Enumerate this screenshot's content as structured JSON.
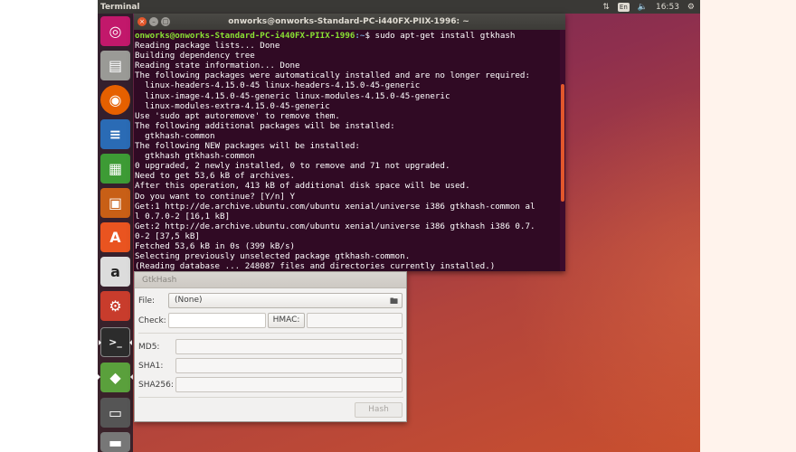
{
  "top_panel": {
    "title": "Terminal",
    "keyboard_layout": "En",
    "clock": "16:53"
  },
  "launcher": {
    "items": [
      {
        "name": "dash",
        "icon": "ubuntu-logo-icon",
        "color": "#c2186b"
      },
      {
        "name": "files",
        "icon": "file-cabinet-icon",
        "color": "#9a9a96"
      },
      {
        "name": "firefox",
        "icon": "firefox-icon",
        "color": "#e66000"
      },
      {
        "name": "writer",
        "icon": "writer-document-icon",
        "color": "#2a6bb5"
      },
      {
        "name": "calc",
        "icon": "calc-spreadsheet-icon",
        "color": "#3d9b35"
      },
      {
        "name": "impress",
        "icon": "impress-presentation-icon",
        "color": "#c85f16"
      },
      {
        "name": "software",
        "icon": "software-center-icon",
        "color": "#e95420"
      },
      {
        "name": "amazon",
        "icon": "amazon-icon",
        "color": "#dcdcdc"
      },
      {
        "name": "settings",
        "icon": "settings-gear-icon",
        "color": "#c83c2c"
      },
      {
        "name": "terminal",
        "icon": "terminal-icon",
        "color": "#2c2c2c"
      },
      {
        "name": "gtkhash",
        "icon": "gtkhash-icon",
        "color": "#5aa03c"
      },
      {
        "name": "save",
        "icon": "floppy-disk-icon",
        "color": "#555555"
      },
      {
        "name": "drive",
        "icon": "drive-icon",
        "color": "#777777"
      }
    ]
  },
  "terminal": {
    "title": "onworks@onworks-Standard-PC-i440FX-PIIX-1996: ~",
    "prompt_user": "onworks@onworks-Standard-PC-i440FX-PIIX-1996",
    "prompt_path": ":~",
    "command": "$ sudo apt-get install gtkhash",
    "lines": [
      "Reading package lists... Done",
      "Building dependency tree",
      "Reading state information... Done",
      "The following packages were automatically installed and are no longer required:",
      "  linux-headers-4.15.0-45 linux-headers-4.15.0-45-generic",
      "  linux-image-4.15.0-45-generic linux-modules-4.15.0-45-generic",
      "  linux-modules-extra-4.15.0-45-generic",
      "Use 'sudo apt autoremove' to remove them.",
      "The following additional packages will be installed:",
      "  gtkhash-common",
      "The following NEW packages will be installed:",
      "  gtkhash gtkhash-common",
      "0 upgraded, 2 newly installed, 0 to remove and 71 not upgraded.",
      "Need to get 53,6 kB of archives.",
      "After this operation, 413 kB of additional disk space will be used.",
      "Do you want to continue? [Y/n] Y",
      "Get:1 http://de.archive.ubuntu.com/ubuntu xenial/universe i386 gtkhash-common al",
      "l 0.7.0-2 [16,1 kB]",
      "Get:2 http://de.archive.ubuntu.com/ubuntu xenial/universe i386 gtkhash i386 0.7.",
      "0-2 [37,5 kB]",
      "Fetched 53,6 kB in 0s (399 kB/s)",
      "Selecting previously unselected package gtkhash-common.",
      "(Reading database ... 248087 files and directories currently installed.)"
    ]
  },
  "gtkhash": {
    "title": "GtkHash",
    "file_label": "File:",
    "file_value": "(None)",
    "check_label": "Check:",
    "check_value": "",
    "hmac_button": "HMAC:",
    "hmac_value": "",
    "md5_label": "MD5:",
    "md5_value": "",
    "sha1_label": "SHA1:",
    "sha1_value": "",
    "sha256_label": "SHA256:",
    "sha256_value": "",
    "hash_button": "Hash"
  }
}
